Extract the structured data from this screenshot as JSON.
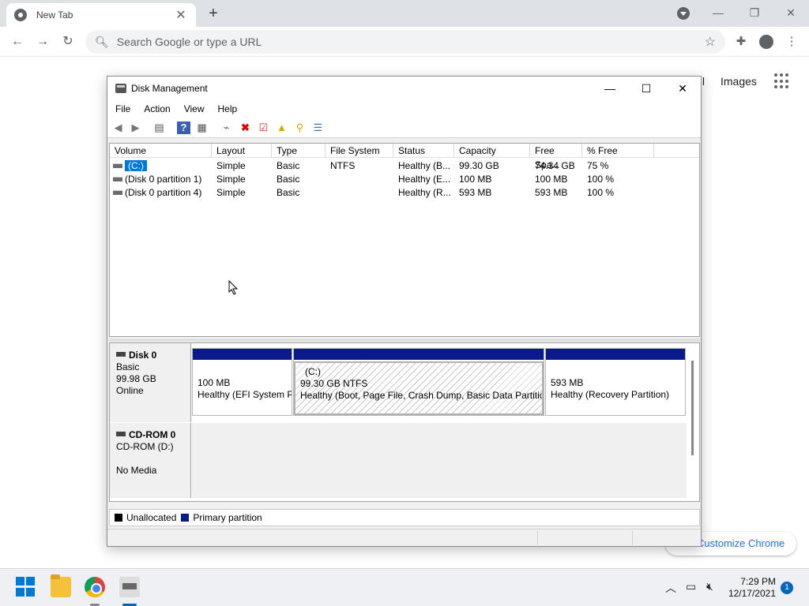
{
  "browser": {
    "tab_title": "New Tab",
    "omnibox_placeholder": "Search Google or type a URL",
    "ntp_links": [
      "ail",
      "Images"
    ],
    "customize_label": "Customize Chrome"
  },
  "dm": {
    "title": "Disk Management",
    "menu": [
      "File",
      "Action",
      "View",
      "Help"
    ],
    "volume_columns": [
      "Volume",
      "Layout",
      "Type",
      "File System",
      "Status",
      "Capacity",
      "Free Spa...",
      "% Free"
    ],
    "volumes": [
      {
        "volume": "(C:)",
        "layout": "Simple",
        "type": "Basic",
        "fs": "NTFS",
        "status": "Healthy (B...",
        "capacity": "99.30 GB",
        "free": "74.34 GB",
        "pct": "75 %"
      },
      {
        "volume": "(Disk 0 partition 1)",
        "layout": "Simple",
        "type": "Basic",
        "fs": "",
        "status": "Healthy (E...",
        "capacity": "100 MB",
        "free": "100 MB",
        "pct": "100 %"
      },
      {
        "volume": "(Disk 0 partition 4)",
        "layout": "Simple",
        "type": "Basic",
        "fs": "",
        "status": "Healthy (R...",
        "capacity": "593 MB",
        "free": "593 MB",
        "pct": "100 %"
      }
    ],
    "disk0": {
      "name": "Disk 0",
      "type": "Basic",
      "size": "99.98 GB",
      "state": "Online",
      "partitions": [
        {
          "label": "",
          "line1": "100 MB",
          "line2": "Healthy (EFI System P"
        },
        {
          "label": "(C:)",
          "line1": "99.30 GB NTFS",
          "line2": "Healthy (Boot, Page File, Crash Dump, Basic Data Partition"
        },
        {
          "label": "",
          "line1": "593 MB",
          "line2": "Healthy (Recovery Partition)"
        }
      ]
    },
    "cdrom": {
      "name": "CD-ROM 0",
      "drive": "CD-ROM (D:)",
      "media": "No Media"
    },
    "legend": [
      "Unallocated",
      "Primary partition"
    ],
    "colors": {
      "unallocated": "#000000",
      "primary": "#0a1a8c"
    }
  },
  "taskbar": {
    "time": "7:29 PM",
    "date": "12/17/2021",
    "notifications": "1"
  }
}
